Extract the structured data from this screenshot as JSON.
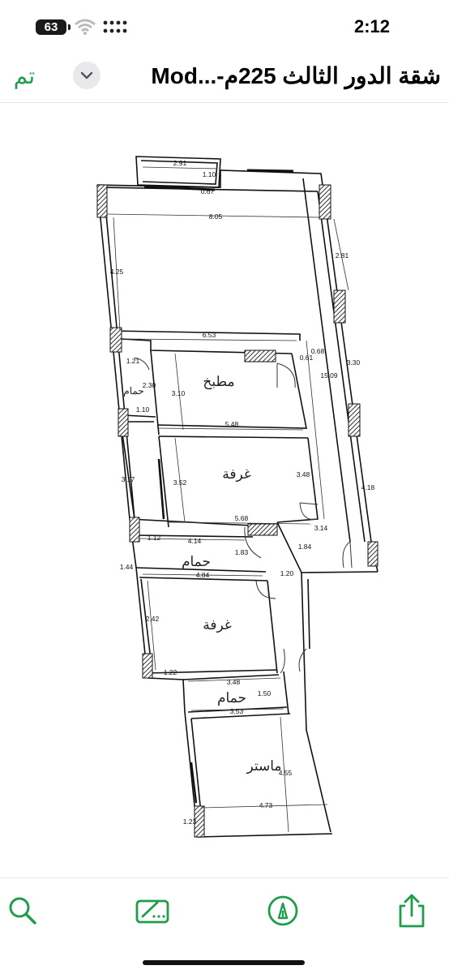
{
  "status_bar": {
    "time": "2:12",
    "battery_level": "63"
  },
  "nav": {
    "done_label": "تم",
    "title": "شقة الدور الثالث 225م-...Mod"
  },
  "floor_plan": {
    "room_labels": {
      "kitchen": "مطبخ",
      "room_1": "غرفة",
      "bath_1": "حمام",
      "bath_small": "حمام",
      "room_2": "غرفة",
      "bath_2": "حمام",
      "master": "ماستر"
    },
    "dimensions": {
      "d_2_91": "2.91",
      "d_1_10_top": "1.10",
      "d_0_67": "0.67",
      "d_8_05": "8.05",
      "d_2_81": "2.81",
      "d_4_25": "4.25",
      "d_6_53": "6.53",
      "d_0_68": "0.68",
      "d_0_61": "0.61",
      "d_3_30": "3.30",
      "d_1_21": "1.21",
      "d_2_30": "2.30",
      "d_3_10": "3.10",
      "d_15_09": "15.09",
      "d_1_10_mid": "1.10",
      "d_5_48": "5.48",
      "d_3_17": "3.17",
      "d_3_52": "3.52",
      "d_3_48_a": "3.48",
      "d_4_18": "4.18",
      "d_5_68": "5.68",
      "d_3_14": "3.14",
      "d_1_12": "1.12",
      "d_4_14": "4.14",
      "d_1_83": "1.83",
      "d_1_84": "1.84",
      "d_1_44": "1.44",
      "d_4_84": "4.84",
      "d_1_20": "1.20",
      "d_2_42": "2.42",
      "d_1_22": "1.22",
      "d_3_48_b": "3.48",
      "d_1_50": "1.50",
      "d_3_53": "3.53",
      "d_4_55": "4.55",
      "d_4_73": "4.73",
      "d_1_23": "1.23"
    }
  },
  "toolbar": {
    "tools": [
      "search-icon",
      "scan-icon",
      "markup-icon",
      "share-icon"
    ],
    "accent_color": "#1e9e4a"
  }
}
